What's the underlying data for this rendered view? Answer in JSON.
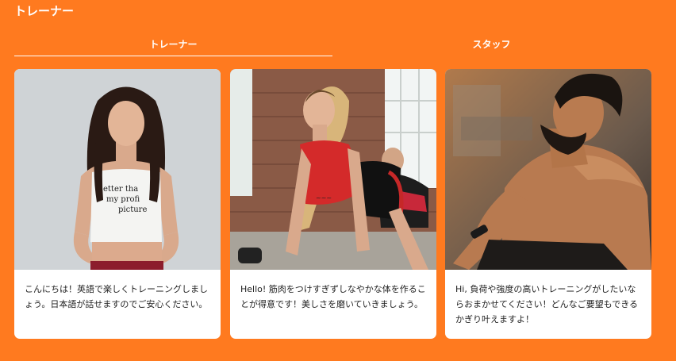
{
  "section": {
    "title": "トレーナー"
  },
  "tabs": [
    {
      "label": "トレーナー",
      "active": true
    },
    {
      "label": "スタッフ",
      "active": false
    }
  ],
  "cards": [
    {
      "photo": "woman-white-crop-top-portrait",
      "shirt_text": [
        "etter tha",
        "my profi",
        "picture"
      ],
      "text": "こんにちは！英語で楽しくトレーニングしましょう。日本語が話せますのでご安心ください。"
    },
    {
      "photo": "woman-red-top-workout-gym",
      "text": "Hello! 筋肉をつけすぎずしなやかな体を作ることが得意です！美しさを磨いていきましょう。"
    },
    {
      "photo": "muscular-bearded-man-gym",
      "text": "Hi, 負荷や強度の高いトレーニングがしたいならおまかせてください！どんなご要望もできるかぎり叶えますよ！"
    }
  ],
  "colors": {
    "background": "#ff7a1f",
    "card": "#ffffff",
    "text": "#1f1f1f"
  }
}
